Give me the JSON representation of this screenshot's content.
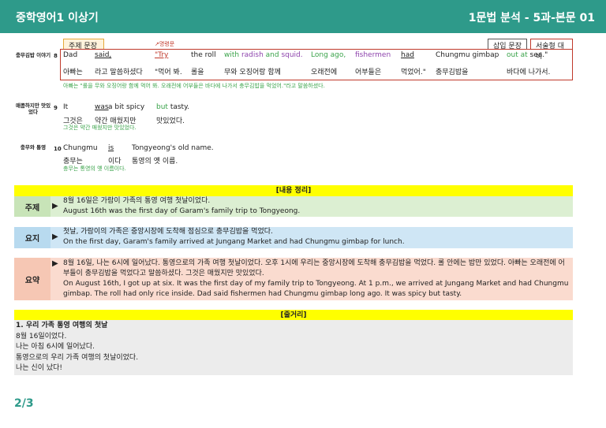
{
  "header": {
    "left": "중학영어1 이상기",
    "right": "1문법 분석 - 5과-본문 01"
  },
  "labels": {
    "theme": "주제 문장",
    "command": "↗명령문",
    "insert": "삽입 문장",
    "writing": "서술형 대비"
  },
  "sentences": [
    {
      "side": "충무김밥 이야기",
      "num": "8",
      "en": [
        "Dad",
        "said,",
        "\"Try",
        "the roll",
        "with radish and squid.",
        "Long ago,",
        "fishermen",
        "had",
        "Chungmu gimbap",
        "out at sea.\""
      ],
      "ko": [
        "아빠는",
        "라고 말씀하셨다",
        "\"먹어 봐.",
        "롤을",
        "무와 오징어랑 함께",
        "오래전에",
        "어부들은",
        "먹었어.\"",
        "충무김밥을",
        "바다에 나가서."
      ],
      "tr": "아빠는 \"롤을 무와 오징어랑 함께 먹어 봐. 오래전에 어부들은 바다에 나가서 충무김밥을 먹었어.\"라고 말씀하셨다."
    },
    {
      "side": "매콤하지만 맛있었다",
      "num": "9",
      "en": [
        "It",
        "was",
        "a bit spicy",
        "but tasty."
      ],
      "ko": [
        "그것은",
        "약간 매웠지만",
        "맛있었다."
      ],
      "tr": "그것은 약간 매웠지만 맛있었다."
    },
    {
      "side": "충무와 통영",
      "num": "10",
      "en": [
        "Chungmu",
        "is",
        "Tongyeong's old name."
      ],
      "ko": [
        "충무는",
        "이다",
        "통영의 옛 이름."
      ],
      "tr": "충무는 통영의 옛 이름이다."
    }
  ],
  "summary": {
    "title": "[내용 정리]",
    "theme": {
      "tag": "주제",
      "ko": "8월 16일은 가람이 가족의 통영 여행 첫날이었다.",
      "en": "August 16th was the first day of Garam's family trip to Tongyeong."
    },
    "point": {
      "tag": "요지",
      "ko": "첫날, 가람이의 가족은 중앙시장에 도착해 점심으로 충무김밥을 먹었다.",
      "en": "On the first day, Garam's family arrived at Jungang Market and had Chungmu gimbap for lunch."
    },
    "sum": {
      "tag": "요약",
      "ko": "8월 16일, 나는 6시에 일어났다. 통영으로의 가족 여행 첫날이었다. 오후 1시에 우리는 중앙시장에 도착해 충무김밥을 먹었다. 롤 안에는 밥만 있었다. 아빠는 오래전에 어부들이 충무김밥을 먹었다고 말씀하셨다. 그것은 매웠지만 맛있었다.",
      "en": "On August 16th, I got up at six. It was the first day of my family trip to Tongyeong. At 1 p.m., we arrived at Jungang Market and had Chungmu gimbap. The roll had only rice inside. Dad said fishermen had Chungmu gimbap long ago. It was spicy but tasty."
    }
  },
  "plot": {
    "title": "[줄거리]",
    "lines": [
      "1. 우리 가족 통영 여행의 첫날",
      "8월 16일이었다.",
      "나는 아침 6시에 일어났다.",
      "통영으로의 우리 가족 여행의 첫날이었다.",
      "나는 신이 났다!"
    ]
  },
  "page": "2/3"
}
